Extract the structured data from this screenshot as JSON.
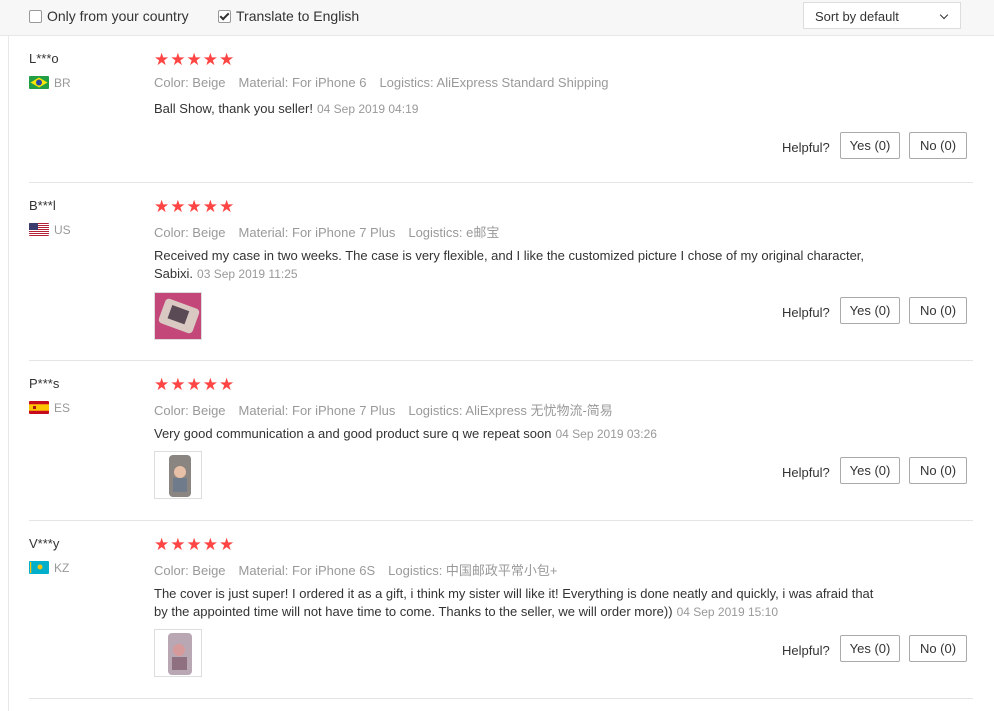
{
  "filters": {
    "only_country_label": "Only from your country",
    "only_country_checked": false,
    "translate_label": "Translate to English",
    "translate_checked": true,
    "sort_label": "Sort by default"
  },
  "helpful_label": "Helpful?",
  "reviews": [
    {
      "user": "L***o",
      "country": "BR",
      "stars": "★★★★★",
      "color": "Color: Beige",
      "material": "Material: For iPhone 6",
      "logistics": "Logistics: AliExpress Standard Shipping",
      "text": "Ball Show, thank you seller!",
      "time": "04 Sep 2019 04:19",
      "yes": "Yes (0)",
      "no": "No (0)"
    },
    {
      "user": "B***l",
      "country": "US",
      "stars": "★★★★★",
      "color": "Color: Beige",
      "material": "Material: For iPhone 7 Plus",
      "logistics": "Logistics: e邮宝",
      "text": "Received my case in two weeks. The case is very flexible, and I like the customized picture I chose of my original character, Sabixi.",
      "time": "03 Sep 2019 11:25",
      "yes": "Yes (0)",
      "no": "No (0)"
    },
    {
      "user": "P***s",
      "country": "ES",
      "stars": "★★★★★",
      "color": "Color: Beige",
      "material": "Material: For iPhone 7 Plus",
      "logistics": "Logistics: AliExpress 无忧物流-简易",
      "text": "Very good communication a and good product sure q we repeat soon",
      "time": "04 Sep 2019 03:26",
      "yes": "Yes (0)",
      "no": "No (0)"
    },
    {
      "user": "V***y",
      "country": "KZ",
      "stars": "★★★★★",
      "color": "Color: Beige",
      "material": "Material: For iPhone 6S",
      "logistics": "Logistics: 中国邮政平常小包+",
      "text": "The cover is just super! I ordered it as a gift, i think my sister will like it! Everything is done neatly and quickly, i was afraid that by the appointed time will not have time to come. Thanks to the seller, we will order more))",
      "time": "04 Sep 2019 15:10",
      "yes": "Yes (0)",
      "no": "No (0)"
    }
  ]
}
